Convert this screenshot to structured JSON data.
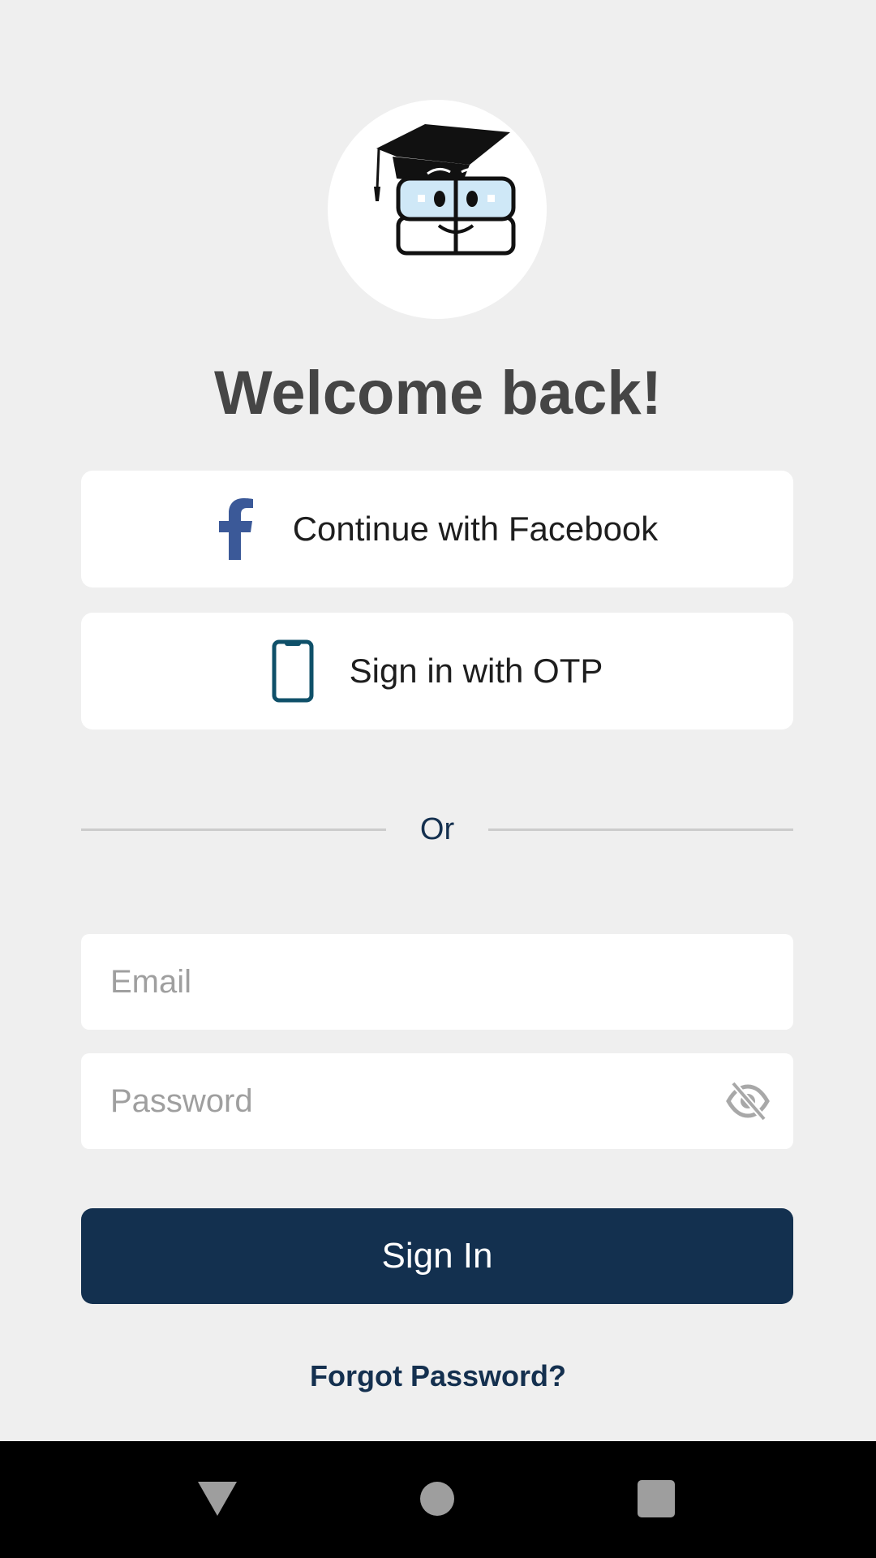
{
  "header": {
    "logo_icon": "graduation-cap-mascot-icon",
    "title": "Welcome back!"
  },
  "social": {
    "facebook_label": "Continue with Facebook",
    "facebook_icon": "facebook-icon",
    "facebook_color": "#3b5998",
    "otp_label": "Sign in with OTP",
    "otp_icon": "phone-icon",
    "otp_icon_color": "#0f5069"
  },
  "divider": {
    "label": "Or"
  },
  "form": {
    "email_placeholder": "Email",
    "email_value": "",
    "password_placeholder": "Password",
    "password_value": "",
    "password_toggle_icon": "eye-off-icon",
    "sign_in_label": "Sign In",
    "forgot_label": "Forgot Password?"
  },
  "navbar": {
    "back_icon": "nav-back-icon",
    "home_icon": "nav-home-icon",
    "recent_icon": "nav-recent-icon"
  },
  "colors": {
    "background": "#efefef",
    "primary": "#13304f",
    "title_text": "#454545"
  }
}
